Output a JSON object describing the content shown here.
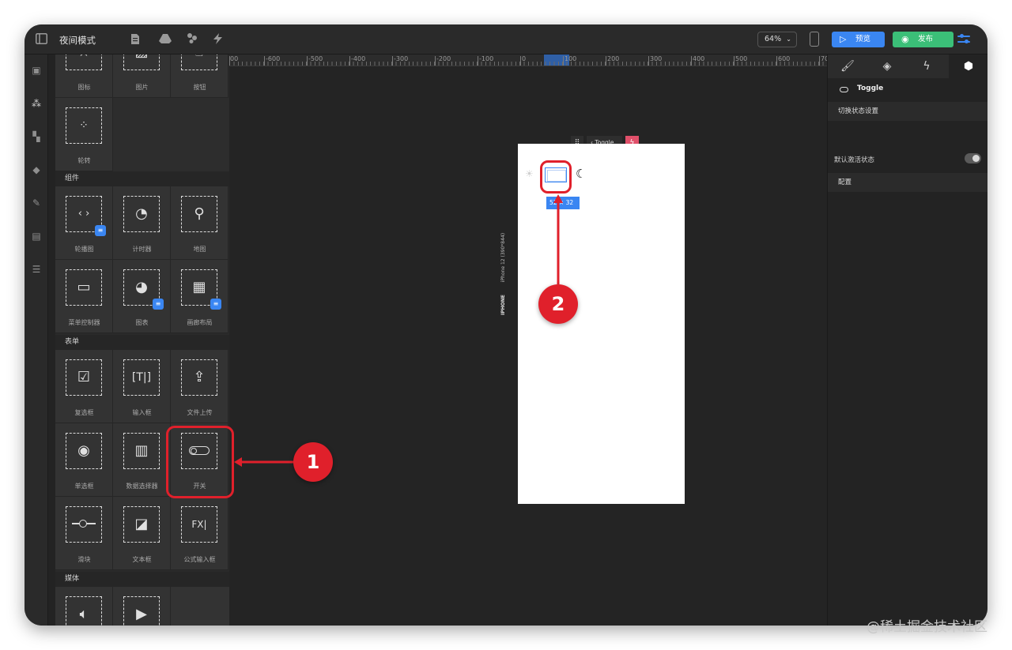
{
  "app": {
    "title": "夜间模式",
    "zoom": "64%",
    "preview_label": "预览",
    "publish_label": "发布"
  },
  "library": {
    "top_row": [
      {
        "label": "图标",
        "icon": "star-icon"
      },
      {
        "label": "图片",
        "icon": "image-icon"
      },
      {
        "label": "按钮",
        "icon": "pointer-icon"
      }
    ],
    "carousel_label": "轮转",
    "sections": {
      "components": "组件",
      "form": "表单",
      "media": "媒体"
    },
    "components": [
      {
        "label": "轮播图",
        "icon": "carousel-icon"
      },
      {
        "label": "计时器",
        "icon": "timer-icon"
      },
      {
        "label": "地图",
        "icon": "map-pin-icon"
      },
      {
        "label": "菜单控制器",
        "icon": "menu-controller-icon"
      },
      {
        "label": "图表",
        "icon": "pie-chart-icon"
      },
      {
        "label": "画廊布局",
        "icon": "gallery-icon"
      }
    ],
    "form": [
      {
        "label": "复选框",
        "icon": "checkbox-icon"
      },
      {
        "label": "输入框",
        "icon": "text-input-icon"
      },
      {
        "label": "文件上传",
        "icon": "upload-icon"
      },
      {
        "label": "单选框",
        "icon": "radio-icon"
      },
      {
        "label": "数据选择器",
        "icon": "data-picker-icon"
      },
      {
        "label": "开关",
        "icon": "toggle-icon"
      },
      {
        "label": "滑块",
        "icon": "slider-icon"
      },
      {
        "label": "文本框",
        "icon": "textarea-icon"
      },
      {
        "label": "公式输入框",
        "icon": "formula-icon"
      }
    ]
  },
  "canvas": {
    "ruler_labels": [
      "00",
      "-600",
      "-500",
      "-400",
      "-300",
      "-200",
      "-100",
      "0",
      "100",
      "200",
      "300",
      "400",
      "500",
      "600",
      "70"
    ],
    "device_name": "IPHONE",
    "device_model": "iPhone 12 (390*844)",
    "selected_element": "Toggle",
    "size_tag": "52 × 32"
  },
  "props": {
    "component_name": "Toggle",
    "group_toggle_settings": "切换状态设置",
    "default_active_label": "默认激活状态",
    "default_active": false,
    "group_config": "配置"
  },
  "annotations": {
    "step1": "1",
    "step2": "2",
    "color": "#e0202b"
  },
  "watermark": "@稀土掘金技术社区",
  "colors": {
    "accent_blue": "#3a86f2",
    "publish_green": "#3bbf78",
    "panel_dark": "#2a2a2a"
  }
}
